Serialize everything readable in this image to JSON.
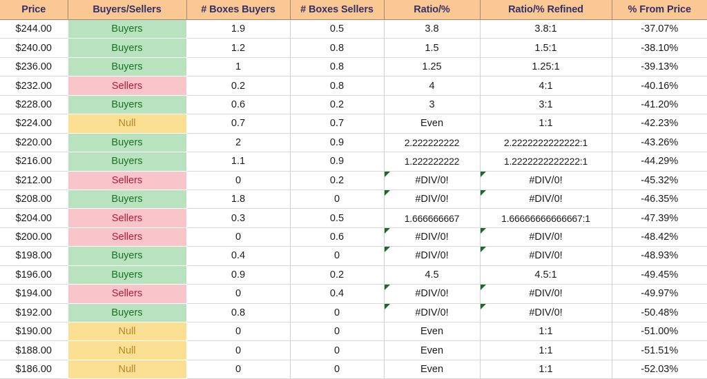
{
  "sheet": {
    "name": "price-ladder-buyers-sellers-table",
    "colors": {
      "header_bg": "#fbc894",
      "header_text": "#31316a",
      "buyers_bg": "#b9e3bf",
      "buyers_text": "#177223",
      "sellers_bg": "#f9c5cb",
      "sellers_text": "#bb1832",
      "null_bg": "#fbdf92",
      "null_text": "#b5872b",
      "error_marker": "#1a6b2a",
      "grid_line": "#d9d9d9"
    }
  },
  "table": {
    "columns": [
      "Price",
      "Buyers/Sellers",
      "# Boxes Buyers",
      "# Boxes Sellers",
      "Ratio/%",
      "Ratio/% Refined",
      "% From Price"
    ],
    "rows": [
      {
        "price": "$244.00",
        "side": "Buyers",
        "boxes_buyers": "1.9",
        "boxes_sellers": "0.5",
        "ratio": "3.8",
        "ratio_refined": "3.8:1",
        "pct_from_price": "-37.07%",
        "ratio_error": false,
        "ratio_refined_error": false
      },
      {
        "price": "$240.00",
        "side": "Buyers",
        "boxes_buyers": "1.2",
        "boxes_sellers": "0.8",
        "ratio": "1.5",
        "ratio_refined": "1.5:1",
        "pct_from_price": "-38.10%",
        "ratio_error": false,
        "ratio_refined_error": false
      },
      {
        "price": "$236.00",
        "side": "Buyers",
        "boxes_buyers": "1",
        "boxes_sellers": "0.8",
        "ratio": "1.25",
        "ratio_refined": "1.25:1",
        "pct_from_price": "-39.13%",
        "ratio_error": false,
        "ratio_refined_error": false
      },
      {
        "price": "$232.00",
        "side": "Sellers",
        "boxes_buyers": "0.2",
        "boxes_sellers": "0.8",
        "ratio": "4",
        "ratio_refined": "4:1",
        "pct_from_price": "-40.16%",
        "ratio_error": false,
        "ratio_refined_error": false
      },
      {
        "price": "$228.00",
        "side": "Buyers",
        "boxes_buyers": "0.6",
        "boxes_sellers": "0.2",
        "ratio": "3",
        "ratio_refined": "3:1",
        "pct_from_price": "-41.20%",
        "ratio_error": false,
        "ratio_refined_error": false
      },
      {
        "price": "$224.00",
        "side": "Null",
        "boxes_buyers": "0.7",
        "boxes_sellers": "0.7",
        "ratio": "Even",
        "ratio_refined": "1:1",
        "pct_from_price": "-42.23%",
        "ratio_error": false,
        "ratio_refined_error": false
      },
      {
        "price": "$220.00",
        "side": "Buyers",
        "boxes_buyers": "2",
        "boxes_sellers": "0.9",
        "ratio": "2.222222222",
        "ratio_refined": "2.2222222222222:1",
        "pct_from_price": "-43.26%",
        "ratio_error": false,
        "ratio_refined_error": false
      },
      {
        "price": "$216.00",
        "side": "Buyers",
        "boxes_buyers": "1.1",
        "boxes_sellers": "0.9",
        "ratio": "1.222222222",
        "ratio_refined": "1.2222222222222:1",
        "pct_from_price": "-44.29%",
        "ratio_error": false,
        "ratio_refined_error": false
      },
      {
        "price": "$212.00",
        "side": "Sellers",
        "boxes_buyers": "0",
        "boxes_sellers": "0.2",
        "ratio": "#DIV/0!",
        "ratio_refined": "#DIV/0!",
        "pct_from_price": "-45.32%",
        "ratio_error": true,
        "ratio_refined_error": true
      },
      {
        "price": "$208.00",
        "side": "Buyers",
        "boxes_buyers": "1.8",
        "boxes_sellers": "0",
        "ratio": "#DIV/0!",
        "ratio_refined": "#DIV/0!",
        "pct_from_price": "-46.35%",
        "ratio_error": true,
        "ratio_refined_error": true
      },
      {
        "price": "$204.00",
        "side": "Sellers",
        "boxes_buyers": "0.3",
        "boxes_sellers": "0.5",
        "ratio": "1.666666667",
        "ratio_refined": "1.66666666666667:1",
        "pct_from_price": "-47.39%",
        "ratio_error": false,
        "ratio_refined_error": false
      },
      {
        "price": "$200.00",
        "side": "Sellers",
        "boxes_buyers": "0",
        "boxes_sellers": "0.6",
        "ratio": "#DIV/0!",
        "ratio_refined": "#DIV/0!",
        "pct_from_price": "-48.42%",
        "ratio_error": true,
        "ratio_refined_error": true
      },
      {
        "price": "$198.00",
        "side": "Buyers",
        "boxes_buyers": "0.4",
        "boxes_sellers": "0",
        "ratio": "#DIV/0!",
        "ratio_refined": "#DIV/0!",
        "pct_from_price": "-48.93%",
        "ratio_error": true,
        "ratio_refined_error": true
      },
      {
        "price": "$196.00",
        "side": "Buyers",
        "boxes_buyers": "0.9",
        "boxes_sellers": "0.2",
        "ratio": "4.5",
        "ratio_refined": "4.5:1",
        "pct_from_price": "-49.45%",
        "ratio_error": false,
        "ratio_refined_error": false
      },
      {
        "price": "$194.00",
        "side": "Sellers",
        "boxes_buyers": "0",
        "boxes_sellers": "0.4",
        "ratio": "#DIV/0!",
        "ratio_refined": "#DIV/0!",
        "pct_from_price": "-49.97%",
        "ratio_error": true,
        "ratio_refined_error": true
      },
      {
        "price": "$192.00",
        "side": "Buyers",
        "boxes_buyers": "0.8",
        "boxes_sellers": "0",
        "ratio": "#DIV/0!",
        "ratio_refined": "#DIV/0!",
        "pct_from_price": "-50.48%",
        "ratio_error": true,
        "ratio_refined_error": true
      },
      {
        "price": "$190.00",
        "side": "Null",
        "boxes_buyers": "0",
        "boxes_sellers": "0",
        "ratio": "Even",
        "ratio_refined": "1:1",
        "pct_from_price": "-51.00%",
        "ratio_error": false,
        "ratio_refined_error": false
      },
      {
        "price": "$188.00",
        "side": "Null",
        "boxes_buyers": "0",
        "boxes_sellers": "0",
        "ratio": "Even",
        "ratio_refined": "1:1",
        "pct_from_price": "-51.51%",
        "ratio_error": false,
        "ratio_refined_error": false
      },
      {
        "price": "$186.00",
        "side": "Null",
        "boxes_buyers": "0",
        "boxes_sellers": "0",
        "ratio": "Even",
        "ratio_refined": "1:1",
        "pct_from_price": "-52.03%",
        "ratio_error": false,
        "ratio_refined_error": false
      }
    ]
  }
}
